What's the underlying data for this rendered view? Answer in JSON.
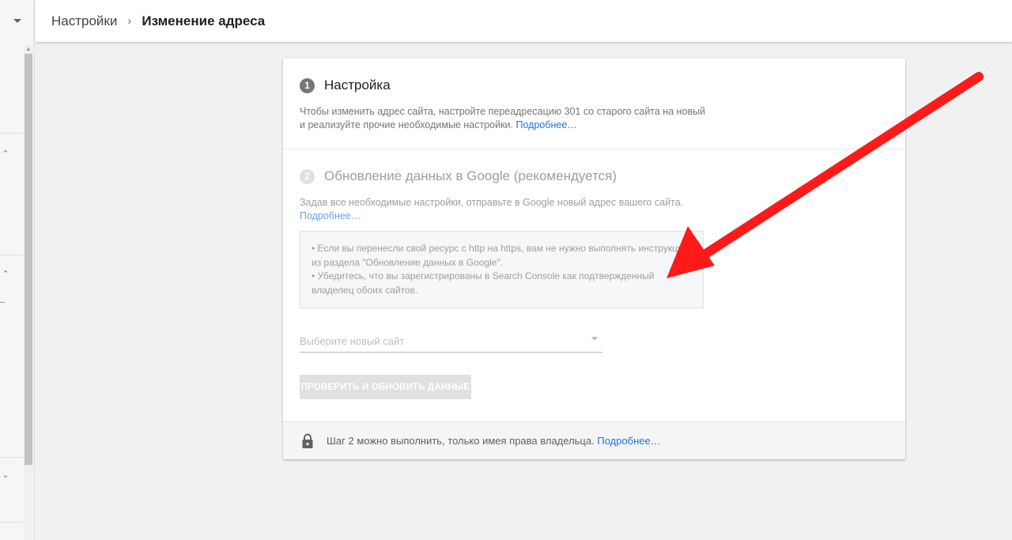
{
  "header": {
    "breadcrumb_parent": "Настройки",
    "breadcrumb_separator": "›",
    "breadcrumb_current": "Изменение адреса"
  },
  "step1": {
    "number": "1",
    "title": "Настройка",
    "description": "Чтобы изменить адрес сайта, настройте переадресацию 301 со старого сайта на новый и реализуйте прочие необходимые настройки.",
    "link": "Подробнее…"
  },
  "step2": {
    "number": "2",
    "title": "Обновление данных в Google (рекомендуется)",
    "description": "Задав все необходимые настройки, отправьте в Google новый адрес вашего сайта.",
    "link": "Подробнее…",
    "notes": [
      "• Если вы перенесли свой ресурс с http на https, вам не нужно выполнять инструкции из раздела \"Обновление данных в Google\".",
      "• Убедитесь, что вы зарегистрированы в Search Console как подтвержденный владелец обоих сайтов."
    ],
    "select_placeholder": "Выберите новый сайт",
    "button_label": "ПРОВЕРИТЬ И ОБНОВИТЬ ДАННЫЕ"
  },
  "footer": {
    "text": "Шаг 2 можно выполнить, только имея права владельца.",
    "link": "Подробнее…"
  },
  "colors": {
    "accent_link": "#1a73e8",
    "step_active": "#757575",
    "step_inactive": "#e0e0e0",
    "annotation_arrow": "#ff1a1a"
  }
}
